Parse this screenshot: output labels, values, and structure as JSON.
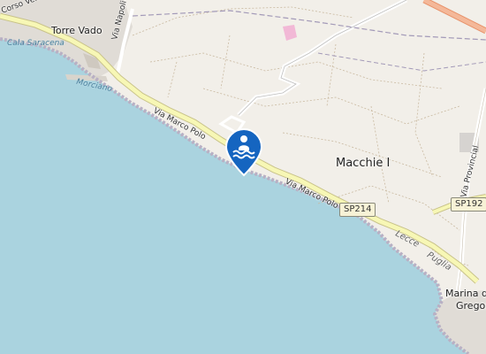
{
  "map": {
    "places": {
      "torre_vado": "Torre Vado",
      "macchie": "Macchie I",
      "marina_line1": "Marina di",
      "marina_line2": "Gregor"
    },
    "roads": {
      "corso_venezia": "Corso Venezia",
      "via_napoli": "Via Napoli",
      "via_marco_polo_a": "Via Marco Polo",
      "via_marco_polo_b": "Via Marco Polo",
      "via_provinciale": "Via Provincial",
      "via_lecce_puglia": "Via P...",
      "sp214": "SP214",
      "sp192": "SP192"
    },
    "water": {
      "cala_saracena": "Cala Saracena",
      "morciano": "Morciano"
    },
    "coast": {
      "lecce": "Lecce",
      "puglia": "Puglia"
    },
    "marker": {
      "icon": "beach-swimmer-icon",
      "color": "#1565c0"
    },
    "colors": {
      "sea": "#aad3df",
      "land": "#f2efe9",
      "main_road": "#f7f7b5",
      "trunk_road": "#f4a583"
    }
  }
}
